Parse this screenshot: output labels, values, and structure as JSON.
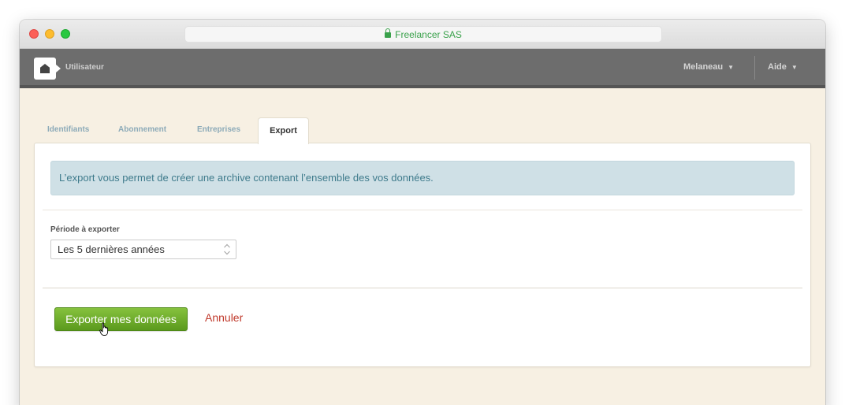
{
  "window": {
    "url_text": "Freelancer SAS"
  },
  "app": {
    "section_title": "Utilisateur",
    "user_menu": "Melaneau",
    "help_menu": "Aide",
    "caret": "▼"
  },
  "tabs": [
    {
      "label": "Identifiants",
      "active": false
    },
    {
      "label": "Abonnement",
      "active": false
    },
    {
      "label": "Entreprises",
      "active": false
    },
    {
      "label": "Export",
      "active": true
    }
  ],
  "export_panel": {
    "info_text": "L’export vous permet de créer une archive contenant l’ensemble des vos données.",
    "period_label": "Période à exporter",
    "period_value": "Les 5 dernières années",
    "submit_label": "Exporter mes données",
    "cancel_label": "Annuler"
  },
  "colors": {
    "accent_green": "#6fb02c",
    "cancel_red": "#c0392b",
    "info_bg": "#cfe0e6",
    "page_bg": "#f7f0e3",
    "appbar_bg": "#6d6d6d"
  }
}
